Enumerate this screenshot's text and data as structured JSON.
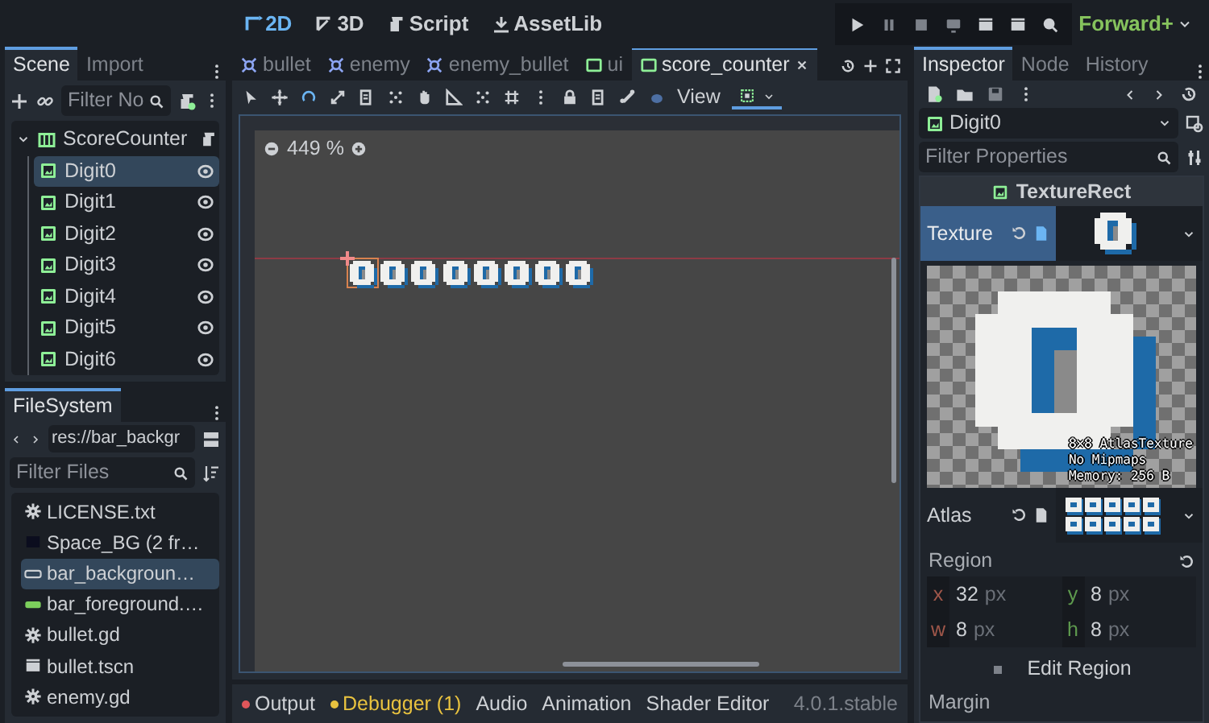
{
  "top_bar": {
    "workspaces": [
      {
        "label": "2D",
        "kind": "planar",
        "selected": true
      },
      {
        "label": "3D",
        "kind": "spatial",
        "selected": false
      },
      {
        "label": "Script",
        "kind": "script",
        "selected": false
      },
      {
        "label": "AssetLib",
        "kind": "assetlib",
        "selected": false
      }
    ],
    "renderer": "Forward+"
  },
  "scene_dock": {
    "tabs": [
      {
        "label": "Scene",
        "selected": true
      },
      {
        "label": "Import",
        "selected": false
      }
    ],
    "filter": {
      "placeholder": "Filter No"
    },
    "tree": [
      {
        "label": "ScoreCounter",
        "kind": "container",
        "has_script": true,
        "expanded": true,
        "selected": false,
        "children": [
          {
            "label": "Digit0",
            "kind": "texture",
            "selected": true
          },
          {
            "label": "Digit1",
            "kind": "texture",
            "selected": false
          },
          {
            "label": "Digit2",
            "kind": "texture",
            "selected": false
          },
          {
            "label": "Digit3",
            "kind": "texture",
            "selected": false
          },
          {
            "label": "Digit4",
            "kind": "texture",
            "selected": false
          },
          {
            "label": "Digit5",
            "kind": "texture",
            "selected": false
          },
          {
            "label": "Digit6",
            "kind": "texture",
            "selected": false
          }
        ]
      }
    ]
  },
  "filesystem": {
    "tabs": [
      {
        "label": "FileSystem",
        "selected": true
      }
    ],
    "path": "res://bar_backgr",
    "filter": {
      "placeholder": "Filter Files"
    },
    "files": [
      {
        "name": "LICENSE.txt",
        "kind": "text",
        "selected": false
      },
      {
        "name": "Space_BG (2 fr…",
        "kind": "image",
        "selected": false
      },
      {
        "name": "bar_backgroun…",
        "kind": "frame",
        "selected": true
      },
      {
        "name": "bar_foreground.…",
        "kind": "bar",
        "selected": false
      },
      {
        "name": "bullet.gd",
        "kind": "script",
        "selected": false
      },
      {
        "name": "bullet.tscn",
        "kind": "scene",
        "selected": false
      },
      {
        "name": "enemy.gd",
        "kind": "script",
        "selected": false
      }
    ]
  },
  "editor": {
    "tabs": [
      {
        "label": "bullet",
        "kind": "node2d",
        "selected": false
      },
      {
        "label": "enemy",
        "kind": "node2d",
        "selected": false
      },
      {
        "label": "enemy_bullet",
        "kind": "node2d",
        "selected": false
      },
      {
        "label": "ui",
        "kind": "control",
        "selected": false
      },
      {
        "label": "score_counter",
        "kind": "control",
        "selected": true
      }
    ],
    "view_menu": "View",
    "zoom": "449 %"
  },
  "bottom_panel": {
    "tabs": [
      {
        "label": "Output",
        "color": "#e0565a",
        "highlighted": false
      },
      {
        "label": "Debugger (1)",
        "color": "#e8c23f",
        "highlighted": true
      },
      {
        "label": "Audio"
      },
      {
        "label": "Animation"
      },
      {
        "label": "Shader Editor"
      }
    ],
    "version": "4.0.1.stable"
  },
  "inspector": {
    "tabs": [
      {
        "label": "Inspector",
        "selected": true
      },
      {
        "label": "Node",
        "selected": false
      },
      {
        "label": "History",
        "selected": false
      }
    ],
    "node": "Digit0",
    "filter": {
      "placeholder": "Filter Properties"
    },
    "class_name": "TextureRect",
    "texture": {
      "label": "Texture",
      "selected": true,
      "info": [
        "8×8 AtlasTexture",
        "No Mipmaps",
        "Memory: 256 B"
      ]
    },
    "atlas": {
      "label": "Atlas"
    },
    "region": {
      "label": "Region",
      "fields": [
        {
          "axis": "x",
          "value": "32",
          "unit": "px",
          "color": "#a0574a"
        },
        {
          "axis": "y",
          "value": "8",
          "unit": "px",
          "color": "#5e9a4e"
        },
        {
          "axis": "w",
          "value": "8",
          "unit": "px",
          "color": "#a0574a"
        },
        {
          "axis": "h",
          "value": "8",
          "unit": "px",
          "color": "#5e9a4e"
        }
      ]
    },
    "edit_region": "Edit Region",
    "margin": "Margin"
  }
}
